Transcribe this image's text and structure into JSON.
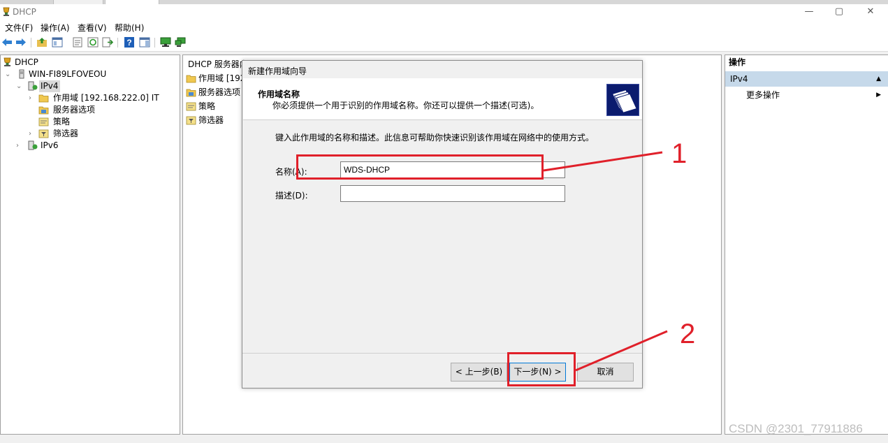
{
  "window": {
    "title": "DHCP",
    "minimize_glyph": "—",
    "maximize_glyph": "▢",
    "close_glyph": "✕"
  },
  "menu": [
    "文件(F)",
    "操作(A)",
    "查看(V)",
    "帮助(H)"
  ],
  "toolbar_icons": [
    "back-arrow-icon",
    "forward-arrow-icon",
    "up-folder-icon",
    "show-hide-tree-icon",
    "properties-icon",
    "refresh-icon",
    "export-list-icon",
    "help-icon",
    "action-pane-icon",
    "computer-icon",
    "network-computer-icon"
  ],
  "tree": {
    "root": "DHCP",
    "server": "WIN-FI89LFOVEOU",
    "ipv4": "IPv4",
    "scope": "作用域 [192.168.222.0] IT",
    "server_options": "服务器选项",
    "policies": "策略",
    "filters": "筛选器",
    "ipv6": "IPv6"
  },
  "content": {
    "header": "DHCP 服务器内",
    "rows": [
      "作用域 [192.",
      "服务器选项",
      "策略",
      "筛选器"
    ]
  },
  "actions": {
    "header": "操作",
    "section": "IPv4",
    "item": "更多操作"
  },
  "wizard": {
    "title": "新建作用域向导",
    "heading": "作用域名称",
    "subheading": "你必须提供一个用于识别的作用域名称。你还可以提供一个描述(可选)。",
    "instruction": "键入此作用域的名称和描述。此信息可帮助你快速识别该作用域在网络中的使用方式。",
    "name_label": "名称(A):",
    "name_value": "WDS-DHCP",
    "desc_label": "描述(D):",
    "desc_value": "",
    "back_button": "< 上一步(B)",
    "next_button": "下一步(N) >",
    "cancel_button": "取消"
  },
  "annotations": {
    "marker_1": "1",
    "marker_2": "2",
    "color": "#e0202a"
  },
  "watermark": "CSDN @2301_77911886"
}
